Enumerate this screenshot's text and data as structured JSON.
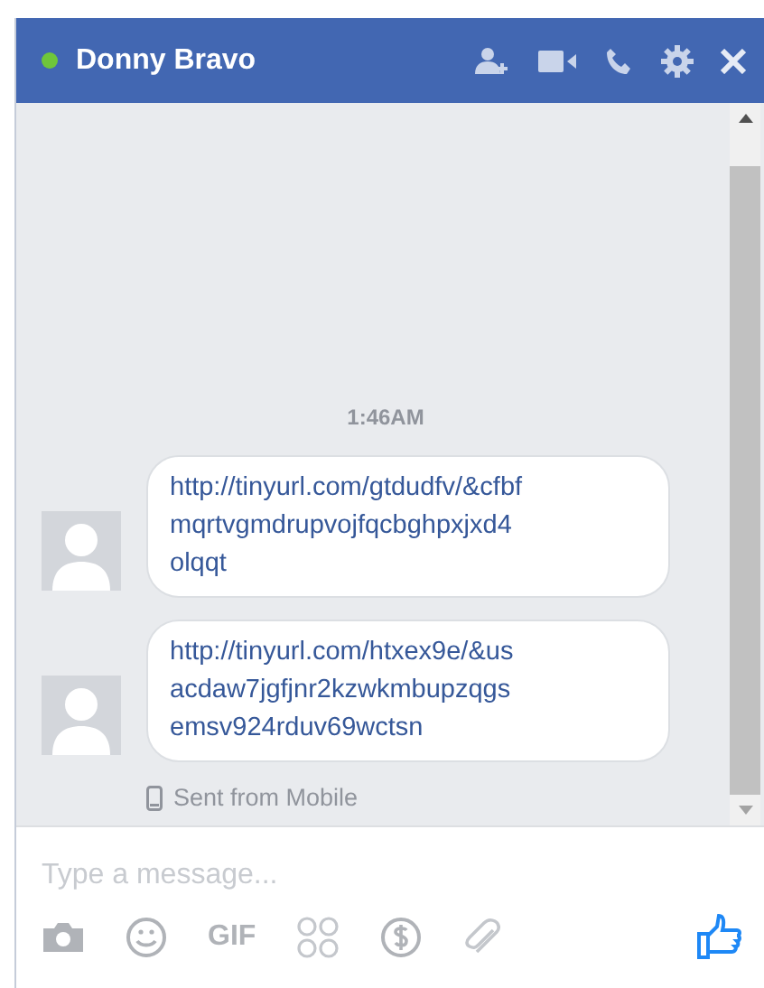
{
  "header": {
    "title": "Donny Bravo",
    "online": true
  },
  "timestamp": "1:46AM",
  "messages": [
    {
      "lines": [
        "http://tinyurl.com/gtdudfv/&cfbf",
        "mqrtvgmdrupvojfqcbghpxjxd4",
        "olqqt"
      ]
    },
    {
      "lines": [
        "http://tinyurl.com/htxex9e/&us",
        "acdaw7jgfjnr2kzwkmbupzqgs",
        "emsv924rduv69wctsn"
      ]
    }
  ],
  "sent_note": "Sent from Mobile",
  "composer": {
    "placeholder": "Type a message...",
    "gif_label": "GIF"
  }
}
